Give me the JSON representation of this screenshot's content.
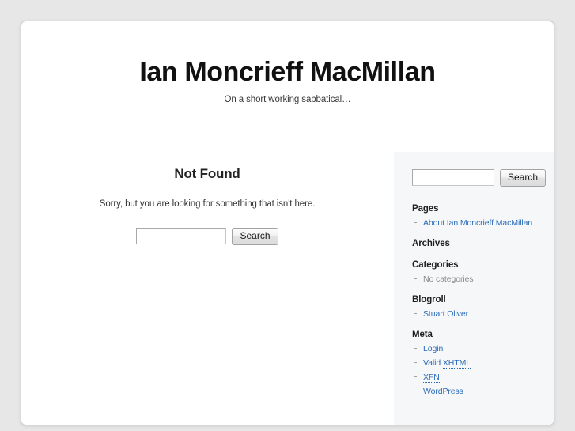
{
  "site": {
    "title": "Ian Moncrieff MacMillan",
    "description": "On a short working sabbatical…"
  },
  "content": {
    "not_found_title": "Not Found",
    "not_found_text": "Sorry, but you are looking for something that isn't here.",
    "search": {
      "value": "",
      "placeholder": "",
      "button_label": "Search"
    }
  },
  "sidebar": {
    "search": {
      "value": "",
      "placeholder": "",
      "button_label": "Search"
    },
    "widgets": [
      {
        "title": "Pages",
        "items": [
          {
            "label": "About Ian Moncrieff MacMillan",
            "link": true
          }
        ]
      },
      {
        "title": "Archives",
        "items": []
      },
      {
        "title": "Categories",
        "items": [
          {
            "label": "No categories",
            "link": false
          }
        ]
      },
      {
        "title": "Blogroll",
        "items": [
          {
            "label": "Stuart Oliver",
            "link": true
          }
        ]
      },
      {
        "title": "Meta",
        "items": [
          {
            "label": "Login",
            "link": true
          },
          {
            "label": "Valid XHTML",
            "link": true,
            "abbr": "XHTML"
          },
          {
            "label": "XFN",
            "link": true,
            "abbr": "XFN"
          },
          {
            "label": "WordPress",
            "link": true
          }
        ]
      }
    ]
  },
  "colors": {
    "page_background": "#e7e7e7",
    "container_background": "#ffffff",
    "sidebar_background": "#f6f7f9",
    "link": "#2b6cb8",
    "muted_text": "#8a8a8a",
    "body_text": "#333333"
  }
}
